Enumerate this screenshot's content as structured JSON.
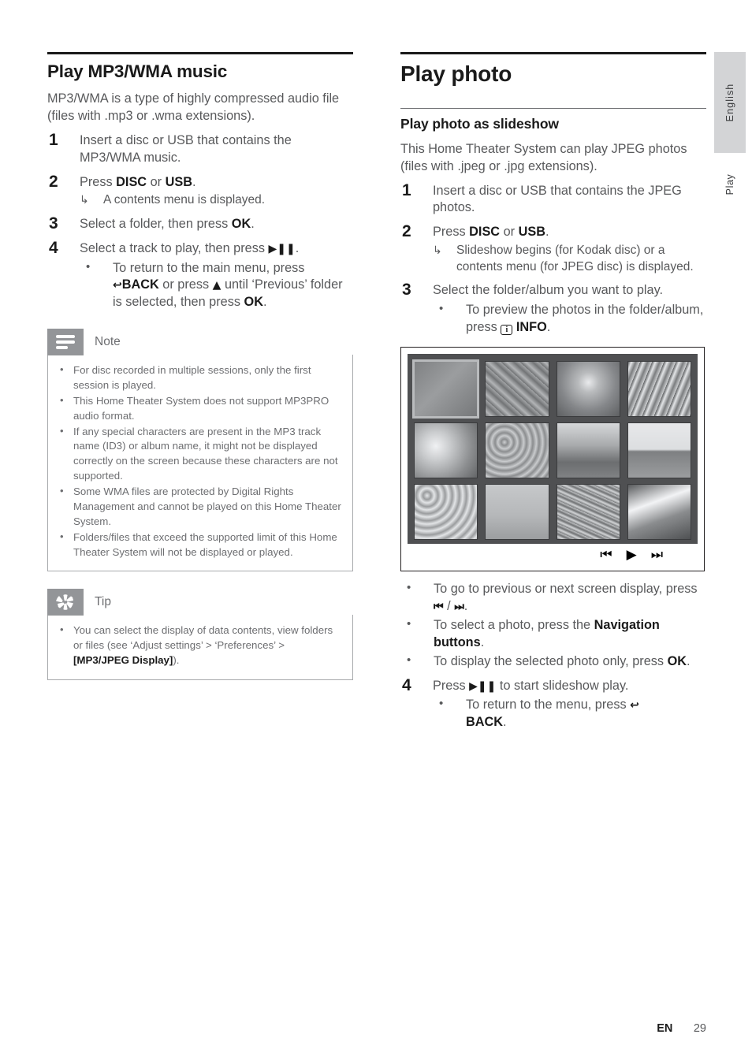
{
  "footer": {
    "language_code": "EN",
    "page_number": "29"
  },
  "side_rail": {
    "language_tab": "English",
    "section_tab": "Play"
  },
  "left_column": {
    "title": "Play MP3/WMA music",
    "intro": "MP3/WMA is a type of highly compressed audio file (files with .mp3 or .wma extensions).",
    "steps": [
      {
        "num": "1",
        "text": "Insert a disc or USB that contains the MP3/WMA music."
      },
      {
        "num": "2",
        "text_prefix": "Press ",
        "bold_1": "DISC",
        "text_mid": " or ",
        "bold_2": "USB",
        "text_suffix": ".",
        "results": [
          {
            "arrow": "↳",
            "text": "A contents menu is displayed."
          }
        ]
      },
      {
        "num": "3",
        "text_prefix": "Select a folder, then press ",
        "bold_1": "OK",
        "text_suffix": "."
      },
      {
        "num": "4",
        "text_prefix": "Select a track to play, then press ",
        "glyph": "▶❚❚",
        "text_suffix": ".",
        "subs": [
          {
            "bullet": "•",
            "part_1": "To return to the main menu, press ",
            "back_glyph": "↩",
            "bold_back": "BACK",
            "part_2": " or press ",
            "up_glyph": "▲",
            "part_3": " until ‘Previous’ folder is selected, then press ",
            "bold_ok": "OK",
            "part_4": "."
          }
        ]
      }
    ],
    "note_box": {
      "icon": "note-lines-icon",
      "label": "Note",
      "items": [
        "For disc recorded in multiple sessions, only the first session is played.",
        "This Home Theater System does not support MP3PRO audio format.",
        "If any special characters are present in the MP3 track name (ID3) or album name, it might not be displayed correctly on the screen because these characters are not supported.",
        "Some WMA files are protected by Digital Rights Management and cannot be played on this Home Theater System.",
        "Folders/files that exceed the supported limit of this Home Theater System will not be displayed or played."
      ]
    },
    "tip_box": {
      "icon": "asterisk-icon",
      "label": "Tip",
      "item_prefix": "You can select the display of data contents, view folders or files (see ‘Adjust settings’ > ‘Preferences’ > ",
      "item_bold": "[MP3/JPEG Display]",
      "item_suffix": ")."
    }
  },
  "right_column": {
    "title": "Play photo",
    "subtitle": "Play photo as slideshow",
    "intro": "This Home Theater System can play JPEG photos (files with .jpeg or .jpg extensions).",
    "steps": [
      {
        "num": "1",
        "text": "Insert a disc or USB that contains the JPEG photos."
      },
      {
        "num": "2",
        "text_prefix": "Press ",
        "bold_1": "DISC",
        "text_mid": " or ",
        "bold_2": "USB",
        "text_suffix": ".",
        "results": [
          {
            "arrow": "↳",
            "text": "Slideshow begins (for Kodak disc) or a contents menu (for JPEG disc) is displayed."
          }
        ]
      },
      {
        "num": "3",
        "text": "Select the folder/album you want to play.",
        "subs": [
          {
            "bullet": "•",
            "part_1": "To preview the photos in the folder/album, press ",
            "info_glyph": "i",
            "bold_info": " INFO",
            "part_2": "."
          }
        ]
      },
      {
        "num": "4",
        "text_prefix": "Press ",
        "glyph": "▶❚❚",
        "text_suffix": " to start slideshow play.",
        "subs": [
          {
            "bullet": "•",
            "part_1": "To return to the menu, press ",
            "back_glyph": "↩",
            "bold_back": "BACK",
            "part_2": "."
          }
        ]
      }
    ],
    "figure": {
      "name": "photo-thumbnail-grid-screen",
      "background_color": "#4f5052",
      "selected_thumbnail_index": 0,
      "thumbnails": [
        {
          "caption": "leaf-photo"
        },
        {
          "caption": "rock-photo"
        },
        {
          "caption": "sunset-sea-photo"
        },
        {
          "caption": "foliage-photo"
        },
        {
          "caption": "children-photo"
        },
        {
          "caption": "flowers-photo"
        },
        {
          "caption": "landscape-photo"
        },
        {
          "caption": "building-photo"
        },
        {
          "caption": "pebbles-photo"
        },
        {
          "caption": "beach-photo"
        },
        {
          "caption": "field-photo"
        },
        {
          "caption": "people-photo"
        }
      ],
      "nav_buttons": [
        {
          "name": "previous-screen-button",
          "glyph": "⏮"
        },
        {
          "name": "play-button",
          "glyph": "▶"
        },
        {
          "name": "next-screen-button",
          "glyph": "⏭"
        }
      ]
    },
    "figure_notes": [
      {
        "bullet": "•",
        "part_1": "To go to previous or next screen display, press ",
        "glyph_prev": "⏮",
        "sep": " / ",
        "glyph_next": "⏭",
        "part_2": "."
      },
      {
        "bullet": "•",
        "part_1": "To select a photo, press the ",
        "bold": "Navigation buttons",
        "part_2": "."
      },
      {
        "bullet": "•",
        "part_1": "To display the selected photo only, press ",
        "bold": "OK",
        "part_2": "."
      }
    ]
  },
  "colors": {
    "text_gray": "#58595b",
    "heading_black": "#1a1a1a",
    "callout_tab": "#939598",
    "side_tab": "#d3d4d6",
    "screen_bg": "#4f5052"
  }
}
